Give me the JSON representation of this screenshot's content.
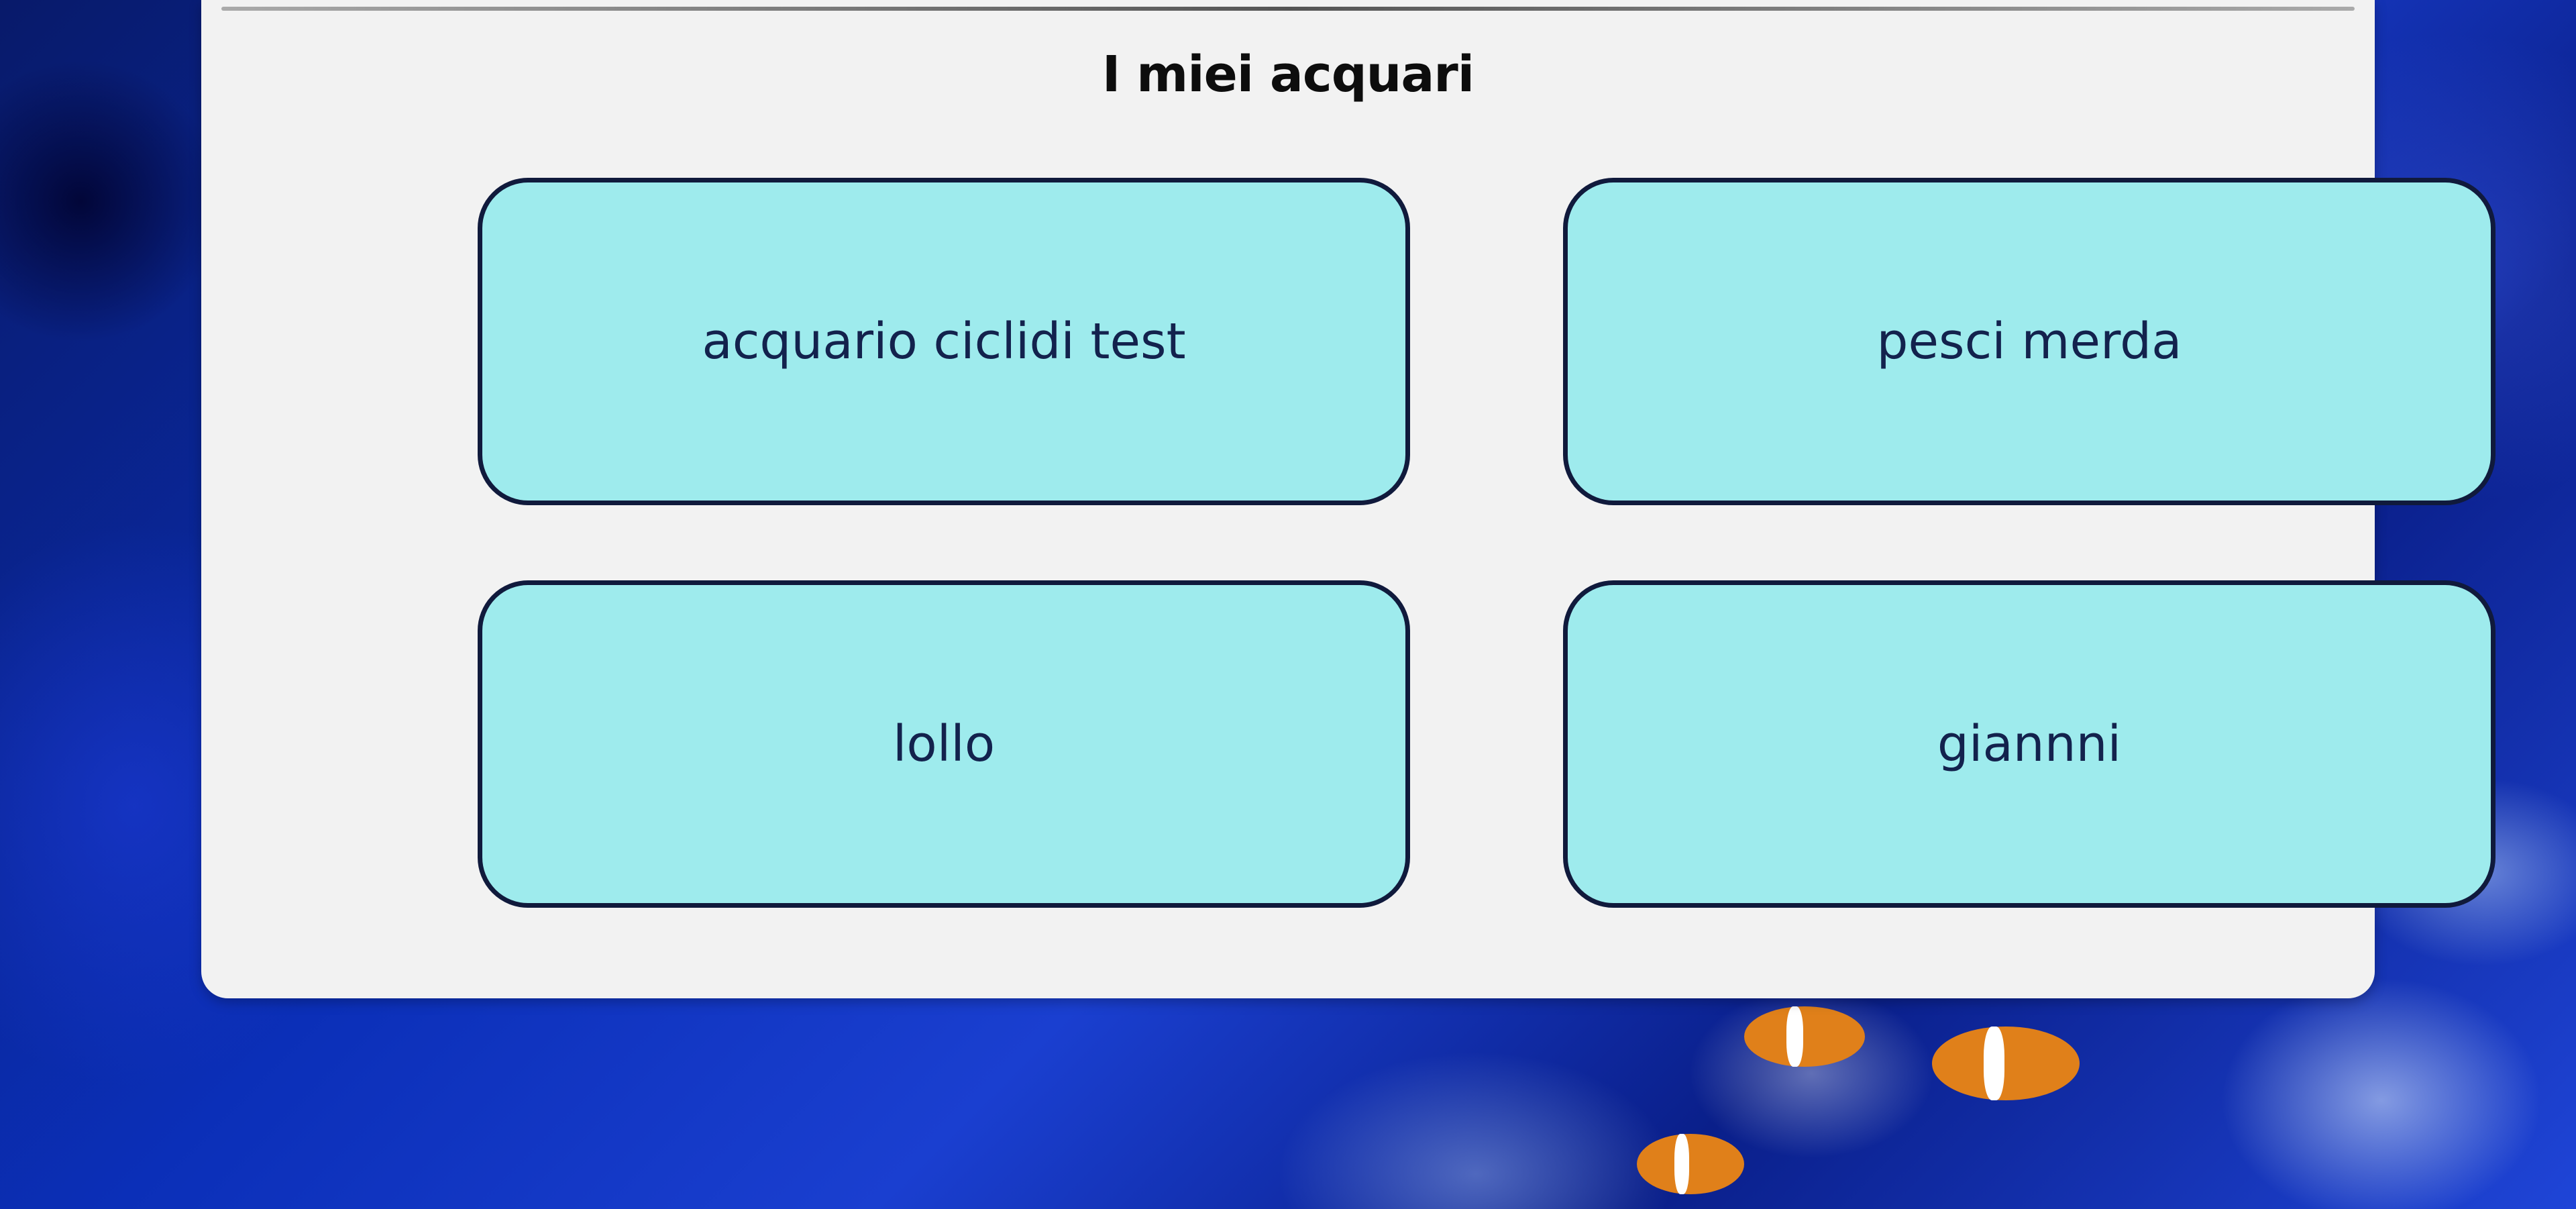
{
  "page": {
    "title": "I miei acquari"
  },
  "aquariums": [
    {
      "label": "acquario ciclidi test"
    },
    {
      "label": "pesci merda"
    },
    {
      "label": "lollo"
    },
    {
      "label": "giannni"
    }
  ],
  "colors": {
    "card_fill": "#9eebed",
    "card_border": "#101a3c",
    "card_text": "#13224d",
    "panel_bg": "#f2f2f2",
    "background": "#0b2fb8"
  }
}
